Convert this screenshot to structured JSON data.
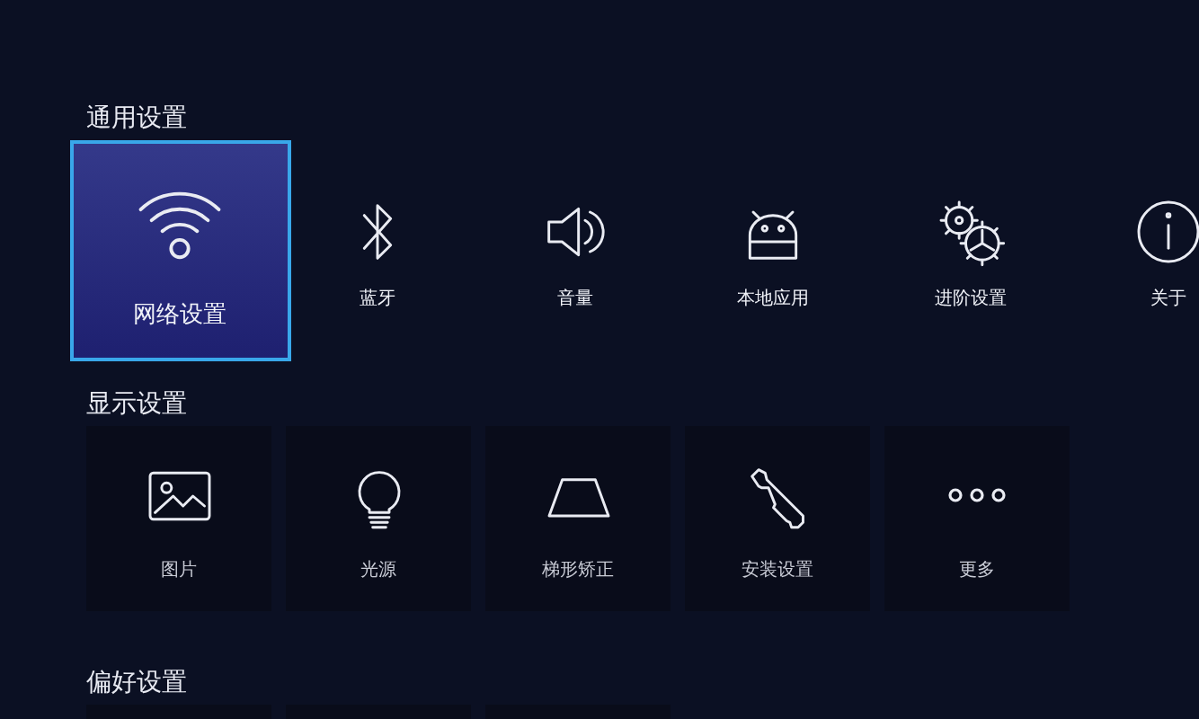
{
  "sections": [
    {
      "title": "通用设置",
      "items": [
        {
          "label": "网络设置",
          "selected": true
        },
        {
          "label": "蓝牙",
          "selected": false
        },
        {
          "label": "音量",
          "selected": false
        },
        {
          "label": "本地应用",
          "selected": false
        },
        {
          "label": "进阶设置",
          "selected": false
        },
        {
          "label": "关于",
          "selected": false
        }
      ]
    },
    {
      "title": "显示设置",
      "items": [
        {
          "label": "图片"
        },
        {
          "label": "光源"
        },
        {
          "label": "梯形矫正"
        },
        {
          "label": "安装设置"
        },
        {
          "label": "更多"
        }
      ]
    },
    {
      "title": "偏好设置"
    }
  ]
}
